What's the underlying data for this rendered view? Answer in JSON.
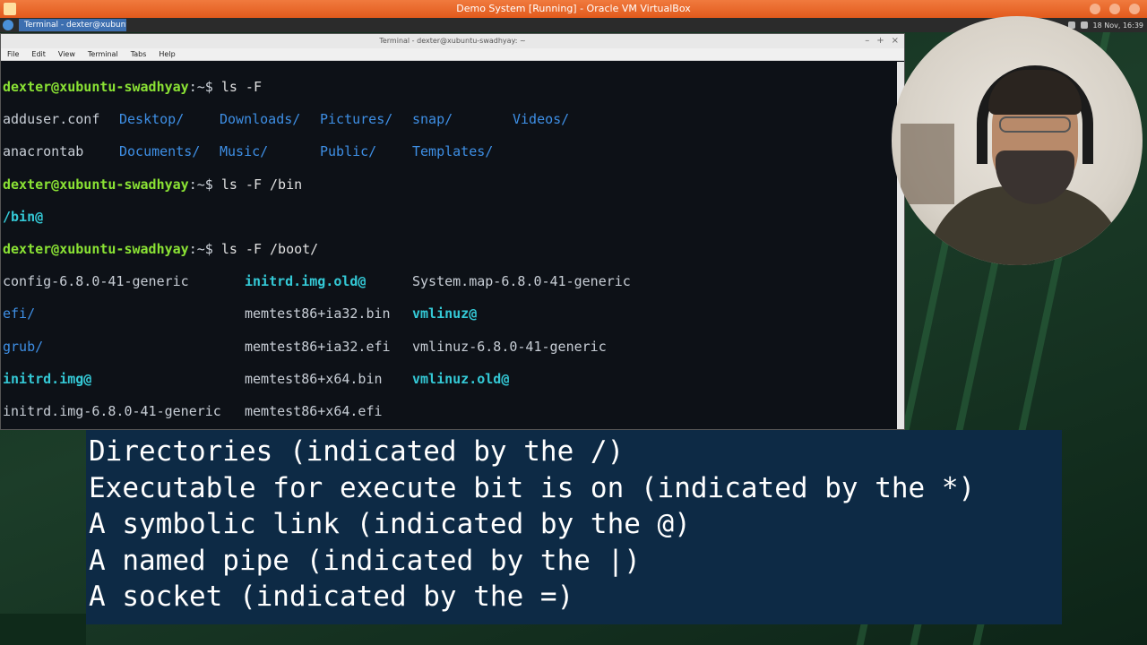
{
  "vbox": {
    "title": "Demo System [Running] - Oracle VM VirtualBox"
  },
  "panel": {
    "task_button": "Terminal - dexter@xubuntu-...",
    "clock": "18 Nov, 16:39"
  },
  "terminal": {
    "title": "Terminal - dexter@xubuntu-swadhyay: ~",
    "menu": [
      "File",
      "Edit",
      "View",
      "Terminal",
      "Tabs",
      "Help"
    ],
    "prompt": "dexter@xubuntu-swadhyay",
    "prompt_suffix": ":~$ ",
    "commands": {
      "c1": "ls -F",
      "c2": "ls -F /bin",
      "c3": "ls -F /boot/"
    },
    "home_listing": {
      "row1": [
        "adduser.conf",
        "Desktop/",
        "Downloads/",
        "Pictures/",
        "snap/",
        "Videos/"
      ],
      "row2": [
        "anacrontab",
        "Documents/",
        "Music/",
        "Public/",
        "Templates/"
      ]
    },
    "bin_output": "/bin@",
    "boot_listing": {
      "col1": [
        "config-6.8.0-41-generic",
        "efi/",
        "grub/",
        "initrd.img@",
        "initrd.img-6.8.0-41-generic"
      ],
      "col2": [
        "initrd.img.old@",
        "memtest86+ia32.bin",
        "memtest86+ia32.efi",
        "memtest86+x64.bin",
        "memtest86+x64.efi"
      ],
      "col3": [
        "System.map-6.8.0-41-generic",
        "vmlinuz@",
        "vmlinuz-6.8.0-41-generic",
        "vmlinuz.old@"
      ]
    }
  },
  "caption": {
    "lines": [
      "Directories (indicated by the /)",
      "Executable for execute bit is on (indicated by the *)",
      "A symbolic link (indicated by the @)",
      "A named pipe (indicated by the |)",
      "A socket (indicated by the =)"
    ]
  },
  "icons": {
    "vm": "virtualbox-icon",
    "menu": "xubuntu-menu-icon"
  }
}
